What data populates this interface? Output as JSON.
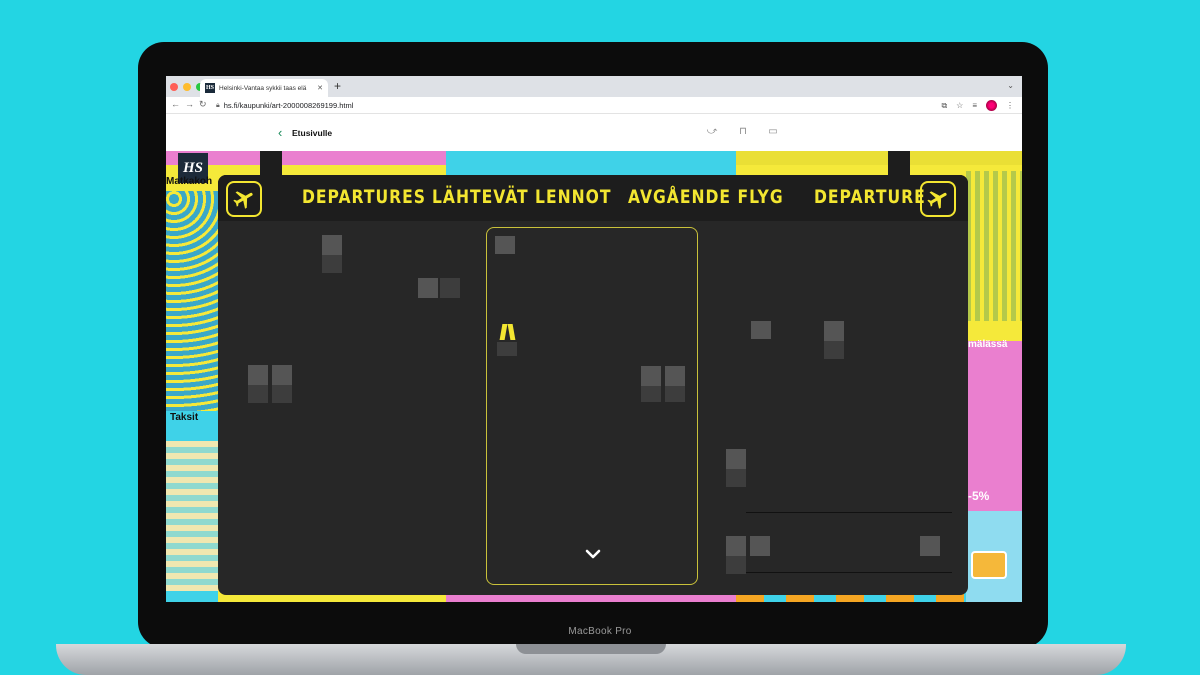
{
  "device": {
    "label": "MacBook Pro"
  },
  "browser": {
    "tab_title": "Helsinki-Vantaa sykkii taas elä",
    "favicon_text": "HS",
    "new_tab": "+",
    "url": "hs.fi/kaupunki/art-2000008269199.html",
    "traffic_lights": {
      "close": "#ff5f57",
      "minimize": "#febc2e",
      "zoom": "#28c840"
    }
  },
  "site": {
    "back_label": "Etusivulle",
    "logo": "HS"
  },
  "article": {
    "labels": {
      "matkakoh": "Matkakoh",
      "taksit": "Taksit",
      "malassa": "mälässä",
      "discount": "-5%"
    }
  },
  "board": {
    "header": [
      "DEPARTURES",
      "LÄHTEVÄT LENNOT",
      "AVGÅENDE FLYG",
      "DEPARTURE"
    ],
    "icons": {
      "left": "airplane-icon",
      "right": "airplane-icon",
      "scroll": "chevron-down-icon"
    },
    "colors": {
      "accent": "#f3e631",
      "background": "#272727"
    }
  },
  "colors": {
    "page_background": "#23d5e3",
    "art_yellow": "#f5e93a",
    "art_pink": "#ea7fcf",
    "art_cyan": "#3fd2e8",
    "brand_green": "#1a8a5a"
  }
}
